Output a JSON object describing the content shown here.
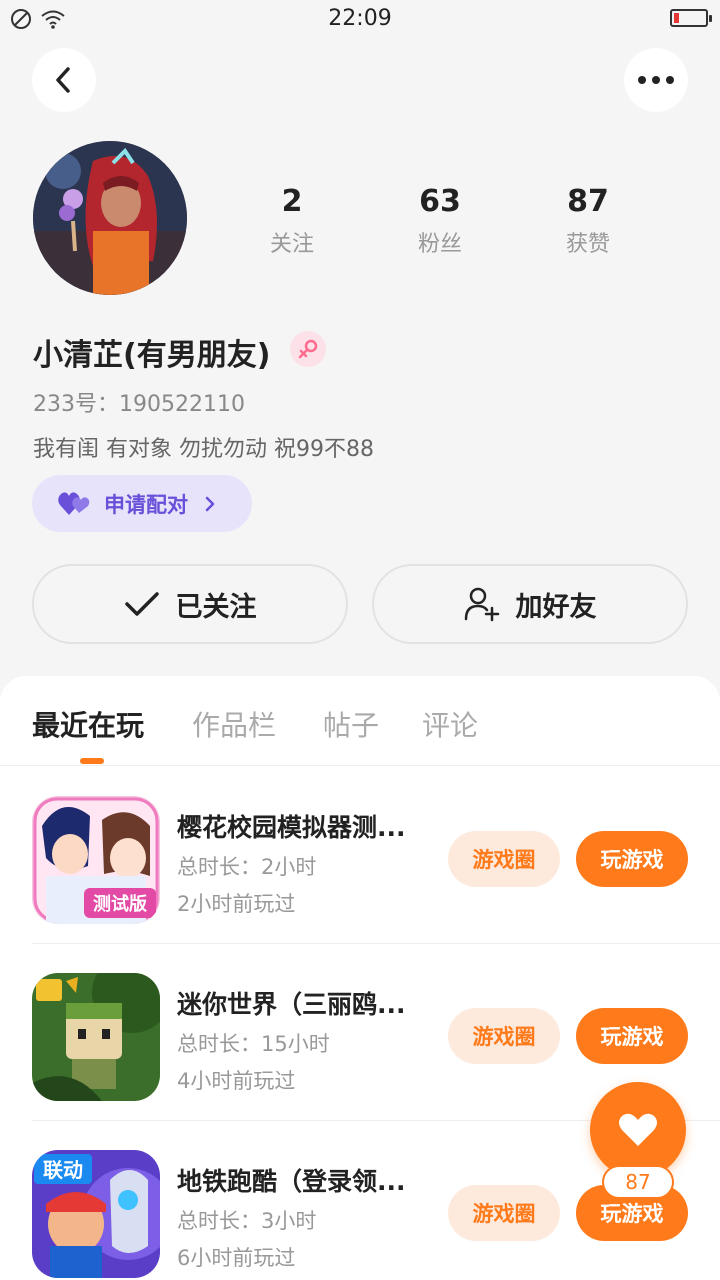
{
  "status_bar": {
    "time": "22:09",
    "battery_level": 0.15
  },
  "profile": {
    "stats": [
      {
        "value": "2",
        "label": "关注"
      },
      {
        "value": "63",
        "label": "粉丝"
      },
      {
        "value": "87",
        "label": "获赞"
      }
    ],
    "username": "小清芷(有男朋友)",
    "gender": "female",
    "uid": "233号：190522110",
    "bio": "我有闺  有对象  勿扰勿动  祝99不88",
    "pair_button": "申请配对",
    "follow_button": "已关注",
    "add_friend_button": "加好友"
  },
  "tabs": [
    "最近在玩",
    "作品栏",
    "帖子",
    "评论"
  ],
  "active_tab": 0,
  "games": [
    {
      "title": "樱花校园模拟器测...",
      "duration": "总时长：2小时",
      "last_played": "2小时前玩过",
      "circle_label": "游戏圈",
      "play_label": "玩游戏",
      "badge": "测试版"
    },
    {
      "title": "迷你世界（三丽鸥...",
      "duration": "总时长：15小时",
      "last_played": "4小时前玩过",
      "circle_label": "游戏圈",
      "play_label": "玩游戏",
      "badge": ""
    },
    {
      "title": "地铁跑酷（登录领...",
      "duration": "总时长：3小时",
      "last_played": "6小时前玩过",
      "circle_label": "游戏圈",
      "play_label": "玩游戏",
      "badge": "联动"
    }
  ],
  "like_fab": {
    "count": "87"
  },
  "colors": {
    "accent": "#ff7a1a",
    "accent_light": "#fdeadd",
    "pair_bg": "#e6e3fb",
    "pair_text": "#6a4fd8"
  }
}
